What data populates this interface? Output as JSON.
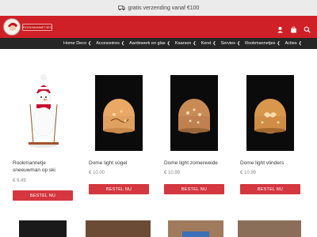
{
  "topbar": {
    "text": "gratis verzending vanaf €100",
    "icon": "truck-icon"
  },
  "header": {
    "logo_text": "ROOKMANNETJES.NL",
    "bg_color": "#d02027",
    "icons": [
      "user-icon",
      "bag-icon",
      "search-icon"
    ]
  },
  "nav": {
    "items": [
      {
        "label": "Home Deco"
      },
      {
        "label": "Accessoires"
      },
      {
        "label": "Aardewerk en glas"
      },
      {
        "label": "Kaarsen"
      },
      {
        "label": "Kerst"
      },
      {
        "label": "Servies"
      },
      {
        "label": "Rookmannetjes"
      },
      {
        "label": "Acties"
      }
    ]
  },
  "products": [
    {
      "name": "Rookmannetje sneeuwman op ski",
      "price": "€ 9.49",
      "button": "BESTEL NU"
    },
    {
      "name": "Dome light vogel",
      "price": "€ 10.00",
      "button": "BESTEL NU"
    },
    {
      "name": "Dome light zomerweide",
      "price": "€ 10.99",
      "button": "BESTEL NU"
    },
    {
      "name": "Dome light vlinders",
      "price": "€ 10.99",
      "button": "BESTEL NU"
    }
  ],
  "colors": {
    "accent": "#d02027",
    "button": "#d4373f",
    "nav_bg": "#262626"
  }
}
